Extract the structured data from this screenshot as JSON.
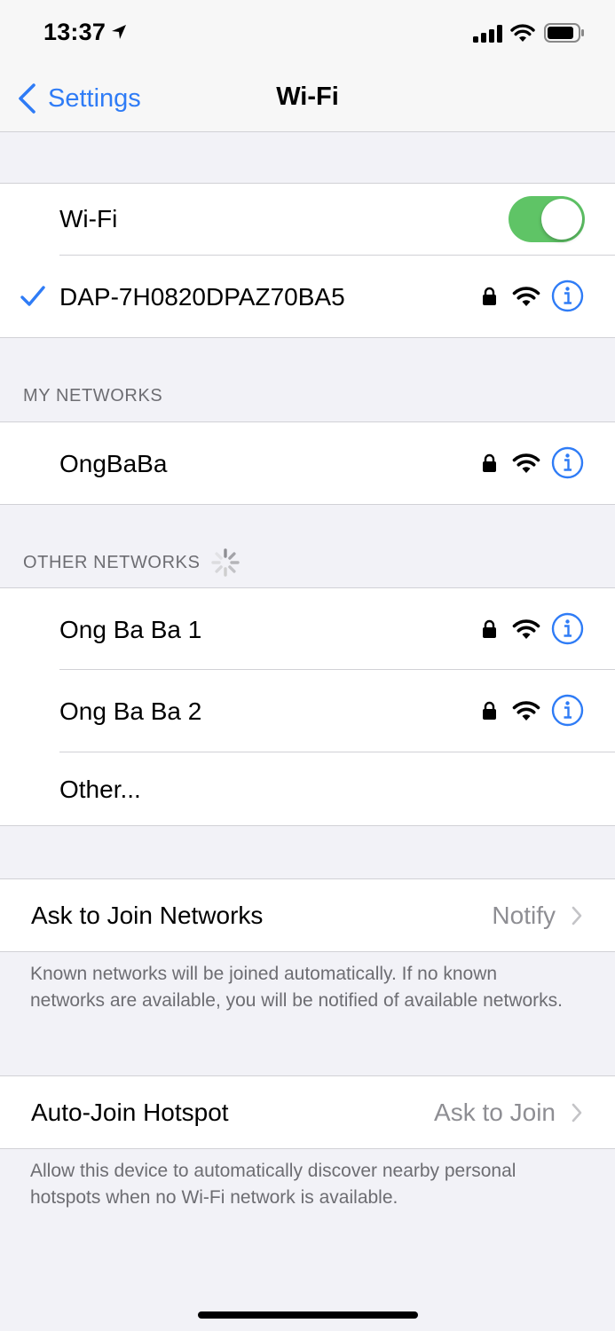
{
  "status_bar": {
    "time": "13:37"
  },
  "nav": {
    "back_label": "Settings",
    "title": "Wi-Fi"
  },
  "wifi_group": {
    "toggle_label": "Wi-Fi",
    "toggle_on": true,
    "connected_network": "DAP-7H0820DPAZ70BA5"
  },
  "my_networks": {
    "header": "MY NETWORKS",
    "items": [
      {
        "name": "OngBaBa"
      }
    ]
  },
  "other_networks": {
    "header": "OTHER NETWORKS",
    "items": [
      {
        "name": "Ong Ba Ba 1"
      },
      {
        "name": "Ong Ba Ba 2"
      }
    ],
    "other_label": "Other..."
  },
  "ask_to_join": {
    "label": "Ask to Join Networks",
    "value": "Notify",
    "footer": "Known networks will be joined automatically. If no known networks are available, you will be notified of available networks."
  },
  "auto_join_hotspot": {
    "label": "Auto-Join Hotspot",
    "value": "Ask to Join",
    "footer": "Allow this device to automatically discover nearby personal hotspots when no Wi-Fi network is available."
  },
  "colors": {
    "accent": "#2f7cf6",
    "toggle_on": "#5fc466",
    "background": "#f2f2f7",
    "secondary_text": "#8e8e93"
  }
}
